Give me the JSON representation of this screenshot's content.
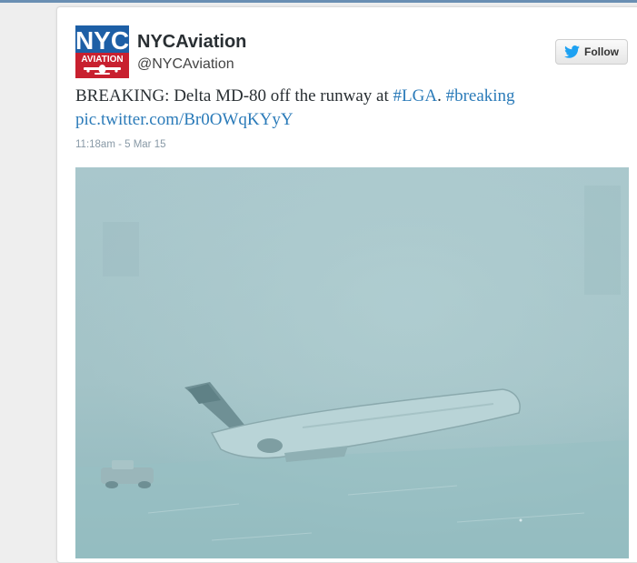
{
  "tweet": {
    "avatar": {
      "logo_top": "NYC",
      "logo_bottom": "AVIATION"
    },
    "display_name": "NYCAviation",
    "handle": "@NYCAviation",
    "follow_label": "Follow",
    "text": {
      "prefix": "BREAKING: Delta MD-80 off the runway at ",
      "hashtag_lga": "#LGA",
      "separator": ". ",
      "hashtag_breaking": "#breaking",
      "pic_link": "pic.twitter.com/Br0OWqKYyY"
    },
    "timestamp": "11:18am - 5 Mar 15"
  },
  "colors": {
    "link": "#2b7bb9",
    "twitter_blue": "#1da1f2",
    "logo_blue": "#1d5fa6",
    "logo_red": "#c8202f",
    "photo_base": "#9fc1c5"
  }
}
